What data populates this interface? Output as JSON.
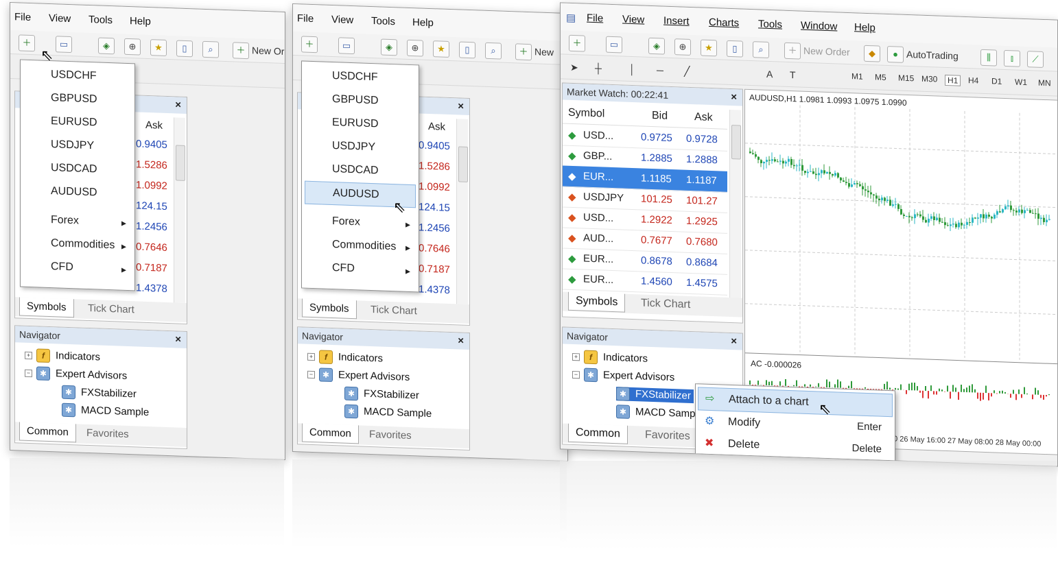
{
  "menus": {
    "short": [
      "File",
      "View",
      "Tools",
      "Help"
    ],
    "full": [
      "File",
      "View",
      "Insert",
      "Charts",
      "Tools",
      "Window",
      "Help"
    ]
  },
  "toolbar": {
    "new_order": "New Order",
    "new_order_short_1": "New Or",
    "new_order_short_2": "New",
    "autotrading": "AutoTrading",
    "timeframes": [
      "M1",
      "M5",
      "M15",
      "M30",
      "H1",
      "H4",
      "D1",
      "W1",
      "MN"
    ]
  },
  "dropdown": {
    "symbols": [
      "USDCHF",
      "GBPUSD",
      "EURUSD",
      "USDJPY",
      "USDCAD",
      "AUDUSD"
    ],
    "submenus": [
      "Forex",
      "Commodities",
      "CFD"
    ],
    "highlighted": "AUDUSD"
  },
  "market_watch": {
    "title": "Market Watch: 00:22:41",
    "columns": [
      "Symbol",
      "Bid",
      "Ask"
    ],
    "rows": [
      {
        "symbol": "USD...",
        "bid": "0.9725",
        "ask": "0.9728",
        "dir": "up"
      },
      {
        "symbol": "GBP...",
        "bid": "1.2885",
        "ask": "1.2888",
        "dir": "up"
      },
      {
        "symbol": "EUR...",
        "bid": "1.1185",
        "ask": "1.1187",
        "dir": "up",
        "selected": true
      },
      {
        "symbol": "USDJPY",
        "bid": "101.25",
        "ask": "101.27",
        "dir": "down"
      },
      {
        "symbol": "USD...",
        "bid": "1.2922",
        "ask": "1.2925",
        "dir": "down"
      },
      {
        "symbol": "AUD...",
        "bid": "0.7677",
        "ask": "0.7680",
        "dir": "down"
      },
      {
        "symbol": "EUR...",
        "bid": "0.8678",
        "ask": "0.8684",
        "dir": "up"
      },
      {
        "symbol": "EUR...",
        "bid": "1.4560",
        "ask": "1.4575",
        "dir": "up"
      }
    ],
    "left_asks": [
      "0.9405",
      "1.5286",
      "1.0992",
      "124.15",
      "1.2456",
      "0.7646",
      "0.7187",
      "1.4378"
    ],
    "left_ask_colors": [
      "#1f46b5",
      "#c4261c",
      "#c4261c",
      "#1f46b5",
      "#1f46b5",
      "#c4261c",
      "#c4261c",
      "#1f46b5"
    ],
    "tabs": [
      "Symbols",
      "Tick Chart"
    ]
  },
  "navigator": {
    "title": "Navigator",
    "items": [
      "Indicators",
      "Expert Advisors",
      "FXStabilizer",
      "MACD Sample"
    ],
    "tabs": [
      "Common",
      "Favorites"
    ]
  },
  "chart": {
    "header": "AUDUSD,H1  1.0981 1.0993 1.0975 1.0990",
    "indicator": "AC -0.000026",
    "dates": "00  26 May 16:00  27 May 08:00  28 May 00:00"
  },
  "context_menu": {
    "items": [
      {
        "label": "Attach to a chart",
        "key": ""
      },
      {
        "label": "Modify",
        "key": "Enter"
      },
      {
        "label": "Delete",
        "key": "Delete"
      }
    ]
  },
  "close_glyph": "×"
}
